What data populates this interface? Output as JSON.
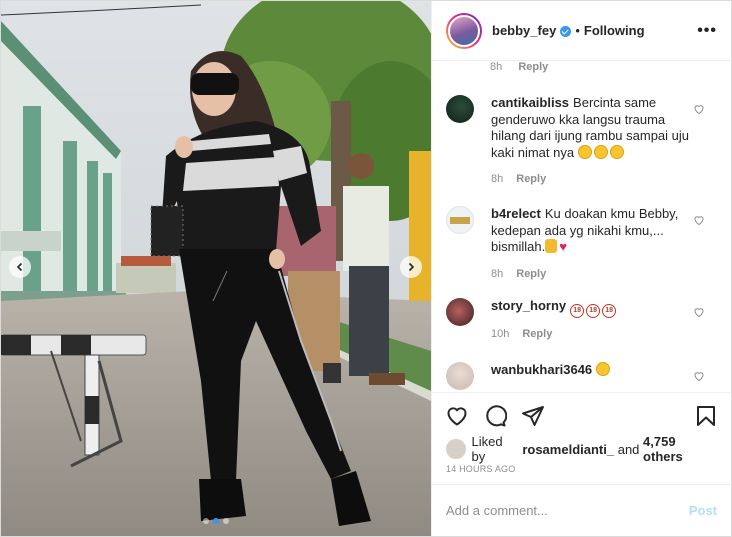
{
  "header": {
    "username": "bebby_fey",
    "separator": "•",
    "follow_status": "Following",
    "more_label": "•••"
  },
  "comments": {
    "top_meta": {
      "time": "8h",
      "reply": "Reply"
    },
    "items": [
      {
        "username": "cantikaibliss",
        "text": "Bercinta same genderuwo kka langsu trauma hilang dari ijung rambu sampai uju kaki nimat nya",
        "emojis": [
          "laugh",
          "laugh",
          "laugh"
        ],
        "time": "8h",
        "reply": "Reply"
      },
      {
        "username": "b4relect",
        "text": "Ku doakan kmu Bebby, kedepan ada yg nikahi kmu,... bismillah.",
        "emojis": [
          "thumbs-up",
          "red-heart"
        ],
        "time": "8h",
        "reply": "Reply"
      },
      {
        "username": "story_horny",
        "text": "",
        "emojis": [
          "no-one-under-eighteen",
          "no-one-under-eighteen",
          "no-one-under-eighteen"
        ],
        "eighteen_label": "18",
        "time": "10h",
        "reply": "Reply"
      },
      {
        "username": "wanbukhari3646",
        "text": "",
        "emojis": [
          "heart-eyes"
        ],
        "time": "",
        "reply": ""
      }
    ]
  },
  "actions": {
    "icons": [
      "heart-icon",
      "comment-icon",
      "share-icon",
      "bookmark-icon"
    ]
  },
  "likes": {
    "prefix": "Liked by",
    "user": "rosameldianti_",
    "middle": "and",
    "count": "4,759 others"
  },
  "timestamp": "14 HOURS AGO",
  "add_comment": {
    "placeholder": "Add a comment...",
    "post_label": "Post"
  },
  "carousel": {
    "dots": 3,
    "active_dot": 2
  },
  "colors": {
    "accent": "#3897f0",
    "post_disabled": "#b2dffc",
    "muted": "#8e8e8e",
    "text": "#262626"
  }
}
